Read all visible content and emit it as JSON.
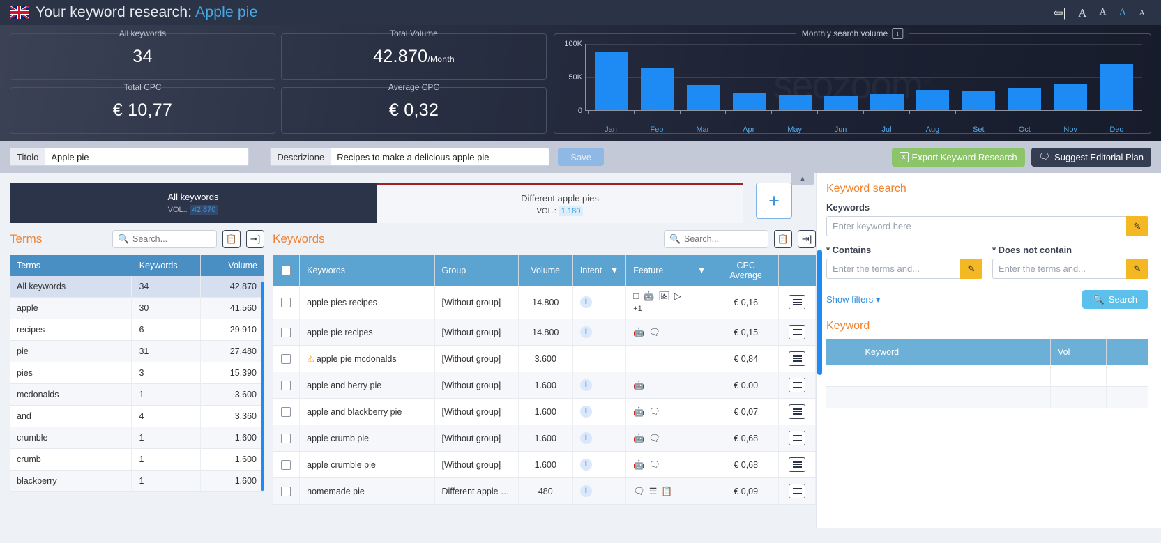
{
  "header": {
    "flag": "uk-flag-icon",
    "title_prefix": "Your keyword research:",
    "keyword": "Apple pie",
    "back_icon": "back-arrow-icon",
    "font_sizes": [
      "A",
      "A",
      "A",
      "A"
    ]
  },
  "stats": [
    {
      "label": "All keywords",
      "value": "34",
      "suffix": ""
    },
    {
      "label": "Total Volume",
      "value": "42.870",
      "suffix": "/Month"
    },
    {
      "label": "Total CPC",
      "value": "€ 10,77",
      "suffix": ""
    },
    {
      "label": "Average CPC",
      "value": "€ 0,32",
      "suffix": ""
    }
  ],
  "chart_panel": {
    "label": "Monthly search volume",
    "info_icon": "info-icon",
    "watermark": "seozoom"
  },
  "chart_data": {
    "type": "bar",
    "title": "Monthly search volume",
    "categories": [
      "Jan",
      "Feb",
      "Mar",
      "Apr",
      "May",
      "Jun",
      "Jul",
      "Aug",
      "Set",
      "Oct",
      "Nov",
      "Dec"
    ],
    "values": [
      88000,
      64000,
      38000,
      26000,
      22000,
      21000,
      24000,
      31000,
      28000,
      34000,
      40000,
      69000
    ],
    "xlabel": "",
    "ylabel": "",
    "ylim": [
      0,
      100000
    ],
    "yticks": [
      0,
      50000,
      100000
    ],
    "ytick_labels": [
      "0",
      "50K",
      "100K"
    ],
    "grid": true,
    "legend": "none",
    "bar_color": "#1e8bf5"
  },
  "toolbar": {
    "title_label": "Titolo",
    "title_value": "Apple pie",
    "desc_label": "Descrizione",
    "desc_value": "Recipes to make a delicious apple pie",
    "save_label": "Save",
    "export_label": "Export Keyword Research",
    "plan_label": "Suggest Editorial Plan",
    "export_icon": "excel-file-icon",
    "plan_icon": "comment-icon"
  },
  "tabs": {
    "vol_prefix": "VOL.:",
    "items": [
      {
        "name": "All keywords",
        "vol": "42.870",
        "active": true
      },
      {
        "name": "Different apple pies",
        "vol": "1.180",
        "active": false
      }
    ],
    "add_label": "+"
  },
  "terms_panel": {
    "title": "Terms",
    "search_placeholder": "Search...",
    "copy_icon": "clipboard-icon",
    "export_icon": "export-icon",
    "columns": [
      "Terms",
      "Keywords",
      "Volume"
    ],
    "rows": [
      {
        "term": "All keywords",
        "keywords": "34",
        "volume": "42.870",
        "selected": true
      },
      {
        "term": "apple",
        "keywords": "30",
        "volume": "41.560",
        "selected": false
      },
      {
        "term": "recipes",
        "keywords": "6",
        "volume": "29.910",
        "selected": false
      },
      {
        "term": "pie",
        "keywords": "31",
        "volume": "27.480",
        "selected": false
      },
      {
        "term": "pies",
        "keywords": "3",
        "volume": "15.390",
        "selected": false
      },
      {
        "term": "mcdonalds",
        "keywords": "1",
        "volume": "3.600",
        "selected": false
      },
      {
        "term": "and",
        "keywords": "4",
        "volume": "3.360",
        "selected": false
      },
      {
        "term": "crumble",
        "keywords": "1",
        "volume": "1.600",
        "selected": false
      },
      {
        "term": "crumb",
        "keywords": "1",
        "volume": "1.600",
        "selected": false
      },
      {
        "term": "blackberry",
        "keywords": "1",
        "volume": "1.600",
        "selected": false
      }
    ]
  },
  "keywords_panel": {
    "title": "Keywords",
    "search_placeholder": "Search...",
    "copy_icon": "clipboard-icon",
    "export_icon": "export-icon",
    "columns": [
      "Keywords",
      "Group",
      "Volume",
      "Intent",
      "Feature",
      "CPC Average"
    ],
    "intent_filter_icon": "filter-icon",
    "feature_filter_icon": "filter-icon",
    "rows": [
      {
        "keyword": "apple pies recipes",
        "warning": false,
        "group": "[Without group]",
        "volume": "14.800",
        "intent": "I",
        "features": [
          "snippet-icon",
          "robot-icon",
          "image-icon",
          "video-icon"
        ],
        "extra": "+1",
        "cpc": "€ 0,16"
      },
      {
        "keyword": "apple pie recipes",
        "warning": false,
        "group": "[Without group]",
        "volume": "14.800",
        "intent": "I",
        "features": [
          "robot-icon",
          "discussion-icon"
        ],
        "extra": "",
        "cpc": "€ 0,15"
      },
      {
        "keyword": "apple pie mcdonalds",
        "warning": true,
        "group": "[Without group]",
        "volume": "3.600",
        "intent": "",
        "features": [],
        "extra": "",
        "cpc": "€ 0,84"
      },
      {
        "keyword": "apple and berry pie",
        "warning": false,
        "group": "[Without group]",
        "volume": "1.600",
        "intent": "I",
        "features": [
          "robot-icon"
        ],
        "extra": "",
        "cpc": "€ 0.00"
      },
      {
        "keyword": "apple and blackberry pie",
        "warning": false,
        "group": "[Without group]",
        "volume": "1.600",
        "intent": "I",
        "features": [
          "robot-icon",
          "discussion-icon"
        ],
        "extra": "",
        "cpc": "€ 0,07"
      },
      {
        "keyword": "apple crumb pie",
        "warning": false,
        "group": "[Without group]",
        "volume": "1.600",
        "intent": "I",
        "features": [
          "robot-icon",
          "discussion-icon"
        ],
        "extra": "",
        "cpc": "€ 0,68"
      },
      {
        "keyword": "apple crumble pie",
        "warning": false,
        "group": "[Without group]",
        "volume": "1.600",
        "intent": "I",
        "features": [
          "robot-icon",
          "discussion-icon"
        ],
        "extra": "",
        "cpc": "€ 0,68"
      },
      {
        "keyword": "homemade pie",
        "warning": false,
        "group": "Different apple pies",
        "volume": "480",
        "intent": "I",
        "features": [
          "discussion-icon",
          "list-icon",
          "carousel-icon"
        ],
        "extra": "",
        "cpc": "€ 0,09"
      }
    ],
    "row_menu_icon": "row-menu-icon"
  },
  "sidebar": {
    "title": "Keyword search",
    "keywords_label": "Keywords",
    "keywords_placeholder": "Enter keyword here",
    "contains_label": "* Contains",
    "contains_placeholder": "Enter the terms and...",
    "not_contains_label": "* Does not contain",
    "not_contains_placeholder": "Enter the terms and...",
    "pencil_icon": "pencil-icon",
    "show_filters": "Show filters",
    "search_button": "Search",
    "search_icon": "search-icon",
    "result_title": "Keyword",
    "result_columns": [
      "",
      "Keyword",
      "Vol",
      ""
    ]
  },
  "collapse_icon": "chevron-up-icon",
  "colors": {
    "accent_orange": "#f1832f",
    "brand_blue": "#1e8bf5",
    "header_blue": "#5ba3d0",
    "dark_navy": "#2b3347",
    "green": "#8cc46a",
    "yellow": "#f4b824",
    "tab_red": "#9e2222"
  }
}
